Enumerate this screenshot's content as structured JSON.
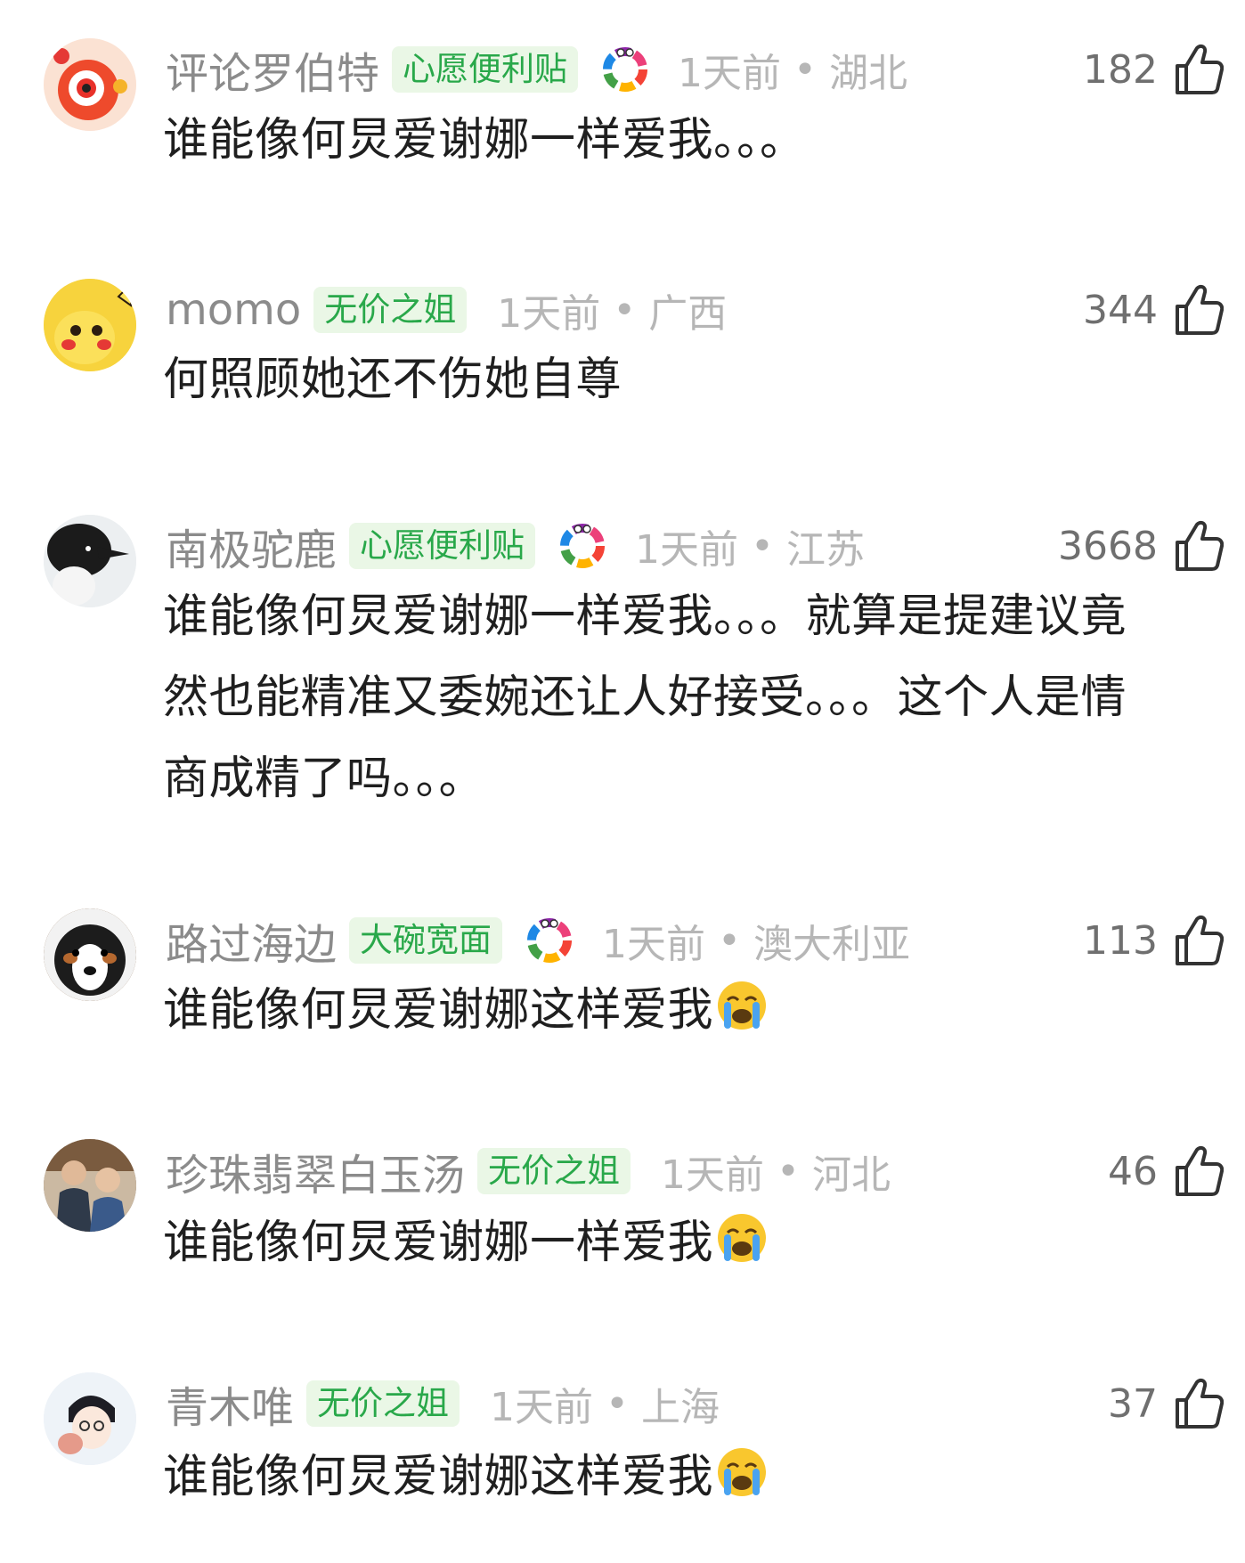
{
  "comments": [
    {
      "username": "评论罗伯特",
      "badge": "心愿便利贴",
      "medal_icon": "rainbow-ring-medal-icon",
      "time": "1天前",
      "separator": "•",
      "region": "湖北",
      "likes": "182",
      "text": "谁能像何炅爱谢娜一样爱我。。。",
      "avatar_icon": "red-cartoon-eye-avatar"
    },
    {
      "username": "momo",
      "badge": "无价之姐",
      "time": "1天前",
      "separator": "•",
      "region": "广西",
      "likes": "344",
      "text": "何照顾她还不伤她自尊",
      "avatar_icon": "yellow-pikachu-avatar"
    },
    {
      "username": "南极驼鹿",
      "badge": "心愿便利贴",
      "medal_icon": "rainbow-ring-medal-icon",
      "time": "1天前",
      "separator": "•",
      "region": "江苏",
      "likes": "3668",
      "text_lines": [
        "谁能像何炅爱谢娜一样爱我。。。就算是提建议竟",
        "然也能精准又委婉还让人好接受。。。这个人是情",
        "商成精了吗。。。"
      ],
      "avatar_icon": "penguin-avatar"
    },
    {
      "username": "路过海边",
      "badge": "大碗宽面",
      "medal_icon": "rainbow-ring-medal-icon",
      "time": "1天前",
      "separator": "•",
      "region": "澳大利亚",
      "likes": "113",
      "text": "谁能像何炅爱谢娜这样爱我",
      "emoji": "crying-face-emoji",
      "avatar_icon": "puppy-avatar"
    },
    {
      "username": "珍珠翡翠白玉汤",
      "badge": "无价之姐",
      "time": "1天前",
      "separator": "•",
      "region": "河北",
      "likes": "46",
      "text": "谁能像何炅爱谢娜一样爱我",
      "emoji": "crying-face-emoji",
      "avatar_icon": "two-people-photo-avatar"
    },
    {
      "username": "青木唯",
      "badge": "无价之姐",
      "time": "1天前",
      "separator": "•",
      "region": "上海",
      "likes": "37",
      "text": "谁能像何炅爱谢娜这样爱我",
      "emoji": "crying-face-emoji",
      "avatar_icon": "anime-boy-avatar"
    }
  ],
  "colors": {
    "badge_bg": "#eaf7e6",
    "badge_text": "#29a84a",
    "username": "#8b8b8b",
    "meta": "#b6b6b6",
    "text": "#1f1f1f"
  }
}
